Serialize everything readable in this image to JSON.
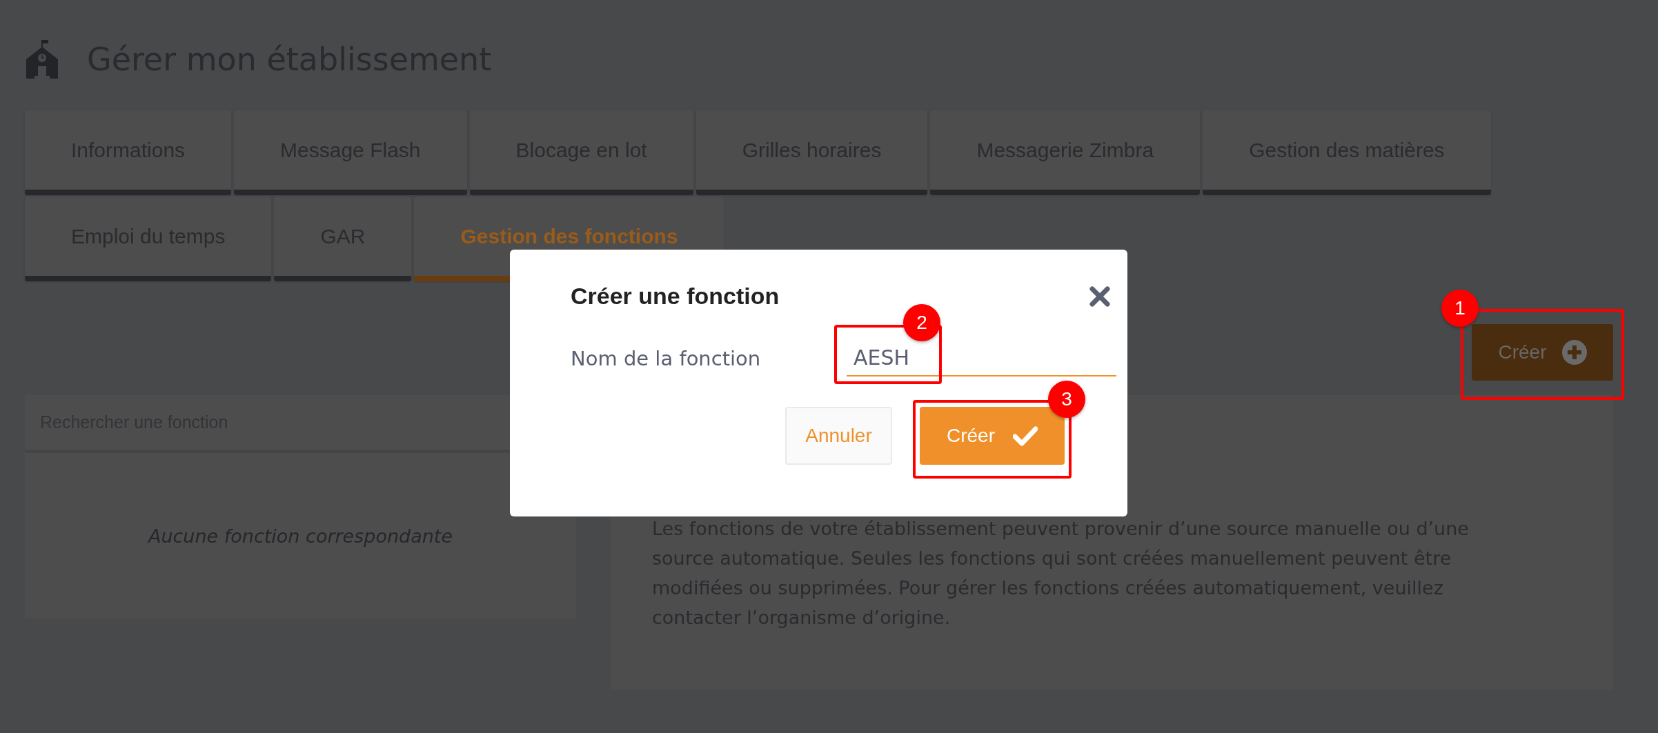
{
  "header": {
    "title": "Gérer mon établissement"
  },
  "tabs": [
    {
      "label": "Informations",
      "selected": false
    },
    {
      "label": "Message Flash",
      "selected": false
    },
    {
      "label": "Blocage en lot",
      "selected": false
    },
    {
      "label": "Grilles horaires",
      "selected": false
    },
    {
      "label": "Messagerie Zimbra",
      "selected": false
    },
    {
      "label": "Gestion des matières",
      "selected": false
    },
    {
      "label": "Emploi du temps",
      "selected": false
    },
    {
      "label": "GAR",
      "selected": false
    },
    {
      "label": "Gestion des fonctions",
      "selected": true
    }
  ],
  "toolbar": {
    "create_button": {
      "label": "Créer",
      "annotation": "1"
    }
  },
  "search_panel": {
    "search": {
      "placeholder": "Rechercher une fonction"
    },
    "empty_message": "Aucune fonction correspondante"
  },
  "info_panel": {
    "text": "Les fonctions de votre établissement peuvent provenir d’une source manuelle ou d’une source automatique. Seules les fonctions qui sont créées manuellement peuvent être modifiées ou supprimées. Pour gérer les fonctions créées automatiquement, veuillez contacter l’organisme d’origine."
  },
  "dialog": {
    "title": "Créer une fonction",
    "field": {
      "label": "Nom de la fonction",
      "value": "AESH",
      "annotation": "2"
    },
    "buttons": [
      {
        "label": "Annuler",
        "kind": "secondary"
      },
      {
        "label": "Créer",
        "kind": "primary",
        "annotation": "3"
      }
    ]
  }
}
